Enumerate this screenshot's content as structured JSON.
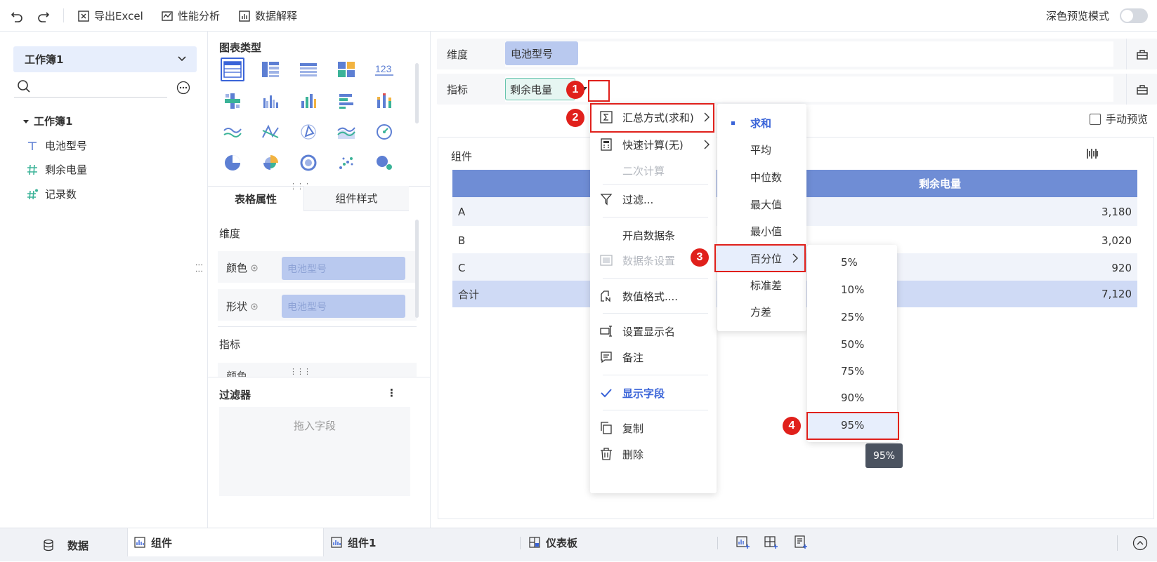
{
  "toolbar": {
    "export_label": "导出Excel",
    "perf_label": "性能分析",
    "explain_label": "数据解释",
    "dark_mode_label": "深色预览模式"
  },
  "left": {
    "workbook_select": "工作簿1",
    "search_placeholder": "",
    "tree_root": "工作簿1",
    "fields": [
      {
        "label": "电池型号",
        "icon": "text-field-icon"
      },
      {
        "label": "剩余电量",
        "icon": "number-field-icon"
      },
      {
        "label": "记录数",
        "icon": "count-field-icon"
      }
    ]
  },
  "mid": {
    "chart_type_title": "图表类型",
    "tab_props": "表格属性",
    "tab_style": "组件样式",
    "dimension_title": "维度",
    "color_label": "颜色",
    "shape_label": "形状",
    "color_field": "电池型号",
    "shape_field": "电池型号",
    "indicator_title": "指标",
    "indicator_hint_partial": "颜色",
    "filter_title": "过滤器",
    "filter_drop": "拖入字段"
  },
  "main": {
    "dim_label": "维度",
    "dim_field": "电池型号",
    "ind_label": "指标",
    "ind_field": "剩余电量",
    "manual_preview": "手动预览",
    "component_title": "组件",
    "table": {
      "header_value": "剩余电量",
      "rows": [
        {
          "name": "A",
          "value": "3,180"
        },
        {
          "name": "B",
          "value": "3,020"
        },
        {
          "name": "C",
          "value": "920"
        }
      ],
      "total": {
        "name": "合计",
        "value": "7,120"
      }
    }
  },
  "menu": {
    "items": [
      {
        "label": "汇总方式(求和)",
        "icon": "sigma-icon"
      },
      {
        "label": "快速计算(无)",
        "icon": "calculator-icon"
      },
      {
        "label": "二次计算",
        "icon": ""
      },
      {
        "label": "过滤...",
        "icon": "filter-icon"
      },
      {
        "label": "开启数据条",
        "icon": ""
      },
      {
        "label": "数据条设置",
        "icon": "databar-icon"
      },
      {
        "label": "数值格式....",
        "icon": "number-format-icon"
      },
      {
        "label": "设置显示名",
        "icon": "rename-icon"
      },
      {
        "label": "备注",
        "icon": "note-icon"
      },
      {
        "label": "显示字段",
        "icon": "check-icon"
      },
      {
        "label": "复制",
        "icon": "copy-icon"
      },
      {
        "label": "删除",
        "icon": "trash-icon"
      }
    ]
  },
  "agg_menu": {
    "items": [
      "求和",
      "平均",
      "中位数",
      "最大值",
      "最小值",
      "百分位",
      "标准差",
      "方差"
    ],
    "selected": "求和"
  },
  "pct_menu": {
    "items": [
      "5%",
      "10%",
      "25%",
      "50%",
      "75%",
      "90%",
      "95%"
    ],
    "highlighted": "95%"
  },
  "tooltip": "95%",
  "badges": [
    "1",
    "2",
    "3",
    "4"
  ],
  "bottom": {
    "data_tab": "数据",
    "tab_component": "组件",
    "tab_component1": "组件1",
    "tab_dashboard": "仪表板"
  },
  "colors": {
    "accent": "#3a64d8",
    "table_header": "#6f8dd5",
    "selected_bg": "#e7eefc",
    "field_pill": "#b9c9ef",
    "highlight_red": "#e0201b",
    "indicator_pill_bg": "#e6f6f2",
    "indicator_pill_border": "#66c4ad"
  }
}
